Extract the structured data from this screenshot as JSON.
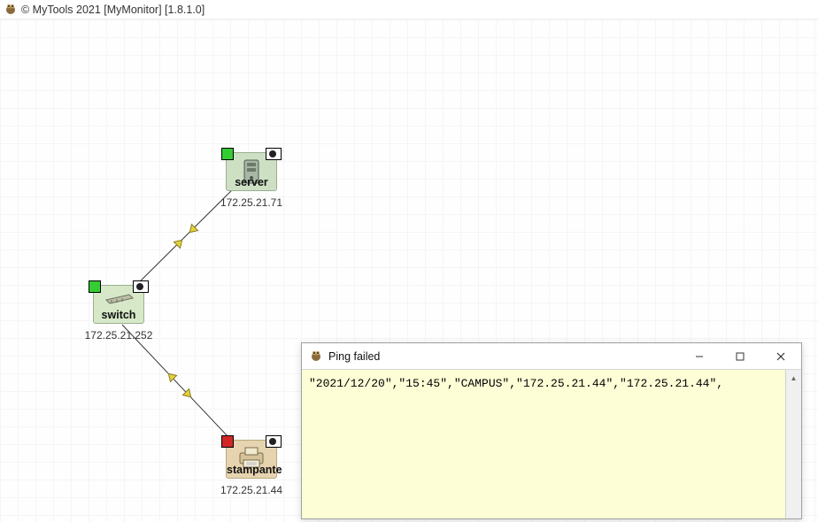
{
  "app": {
    "copyright_title": "© MyTools 2021 [MyMonitor] [1.8.1.0]"
  },
  "nodes": {
    "server": {
      "label": "server",
      "ip": "172.25.21.71",
      "status_color": "#33cc33"
    },
    "switch": {
      "label": "switch",
      "ip": "172.25.21.252",
      "status_color": "#33cc33"
    },
    "printer": {
      "label": "stampante",
      "ip": "172.25.21.44",
      "status_color": "#d22626"
    }
  },
  "popup": {
    "title": "Ping failed",
    "log_line": "\"2021/12/20\",\"15:45\",\"CAMPUS\",\"172.25.21.44\",\"172.25.21.44\","
  }
}
